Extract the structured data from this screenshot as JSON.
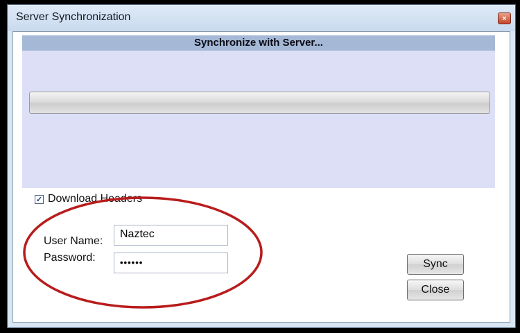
{
  "window": {
    "title": "Server Synchronization",
    "close_glyph": "×"
  },
  "panel": {
    "header": "Synchronize with Server...",
    "progress": 0
  },
  "options": {
    "download_headers_label": "Download Headers",
    "download_headers_checked": true,
    "check_glyph": "✓"
  },
  "login": {
    "user_label": "User Name:",
    "user_value": "Naztec",
    "password_label": "Password:",
    "password_value": "••••••"
  },
  "buttons": {
    "sync": "Sync",
    "close": "Close"
  },
  "colors": {
    "panel": "#dcdff6",
    "panel_header": "#a5b8d6",
    "annotation": "#b81c1c"
  }
}
